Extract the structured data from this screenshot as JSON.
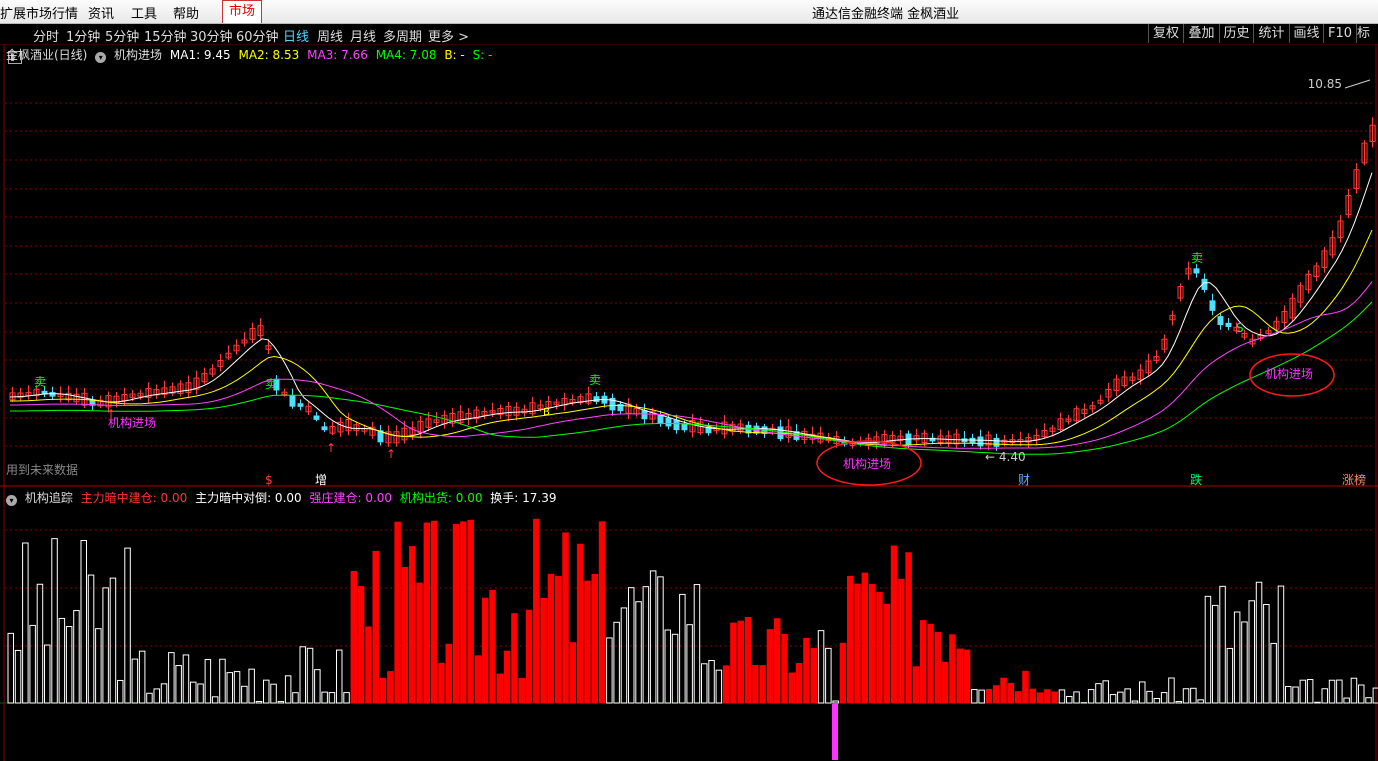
{
  "menubar": {
    "items": [
      "扩展市场行情",
      "资讯",
      "工具",
      "帮助"
    ],
    "market_tab": "市场",
    "window_title": "通达信金融终端 金枫酒业"
  },
  "periodbar": {
    "items": [
      "分时",
      "1分钟",
      "5分钟",
      "15分钟",
      "30分钟",
      "60分钟",
      "日线",
      "周线",
      "月线",
      "多周期",
      "更多 >"
    ],
    "active": "日线",
    "right_buttons": [
      "复权",
      "叠加",
      "历史",
      "统计",
      "画线",
      "F10",
      "标记"
    ]
  },
  "main_legend": {
    "stock": "金枫酒业(日线)",
    "indicator": "机构进场",
    "ma1": "MA1: 9.45",
    "ma2": "MA2: 8.53",
    "ma3": "MA3: 7.66",
    "ma4": "MA4: 7.08",
    "b": "B: -",
    "s": "S: -"
  },
  "sub_legend": {
    "indicator": "机构追踪",
    "l1": "主力暗中建仓: 0.00",
    "l2": "主力暗中对倒: 0.00",
    "l3": "强庄建仓: 0.00",
    "l4": "机构出货: 0.00",
    "l5": "换手: 17.39"
  },
  "future_data_label": "用到未来数据",
  "high_label": "10.85",
  "low_label": "4.40",
  "colors": {
    "up": "#ff3b3b",
    "down": "#4fe0ff",
    "ma1": "#ffffff",
    "ma2": "#ffff00",
    "ma3": "#ff44ff",
    "ma4": "#00ff00",
    "grid": "#8a0000",
    "jigou": "#ff33ff",
    "buildup": "#ff0000"
  },
  "chart_data": [
    {
      "type": "candlestick",
      "title": "金枫酒业(日线)",
      "indicator": "机构进场",
      "price_range": [
        4.4,
        10.85
      ],
      "annotations": [
        "机构进场",
        "机构进场",
        "机构进场",
        "卖",
        "卖",
        "卖",
        "卖",
        "S",
        "B",
        "4.40",
        "10.85"
      ],
      "event_markers": [
        "$",
        "增",
        "财",
        "跌",
        "涨榜"
      ],
      "series": [
        {
          "name": "MA1",
          "value": 9.45
        },
        {
          "name": "MA2",
          "value": 8.53
        },
        {
          "name": "MA3",
          "value": 7.66
        },
        {
          "name": "MA4",
          "value": 7.08
        }
      ]
    },
    {
      "type": "bar",
      "title": "机构追踪",
      "series": [
        {
          "name": "主力暗中建仓",
          "value": 0.0
        },
        {
          "name": "主力暗中对倒",
          "value": 0.0
        },
        {
          "name": "强庄建仓",
          "value": 0.0
        },
        {
          "name": "机构出货",
          "value": 0.0
        },
        {
          "name": "换手",
          "value": 17.39
        }
      ]
    }
  ]
}
